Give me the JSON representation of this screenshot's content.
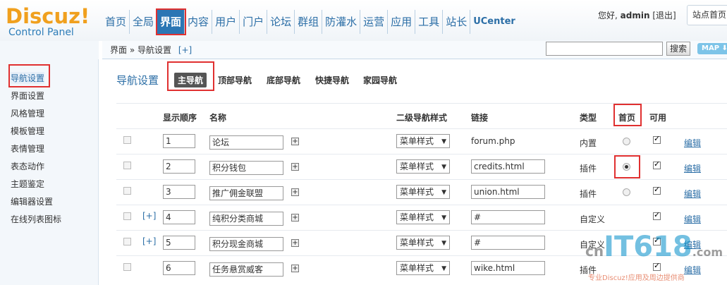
{
  "logo": {
    "main": "Discuz!",
    "sub": "Control Panel"
  },
  "topnav": [
    "首页",
    "全局",
    "界面",
    "内容",
    "用户",
    "门户",
    "论坛",
    "群组",
    "防灌水",
    "运营",
    "应用",
    "工具",
    "站长",
    "UCenter"
  ],
  "user": {
    "greeting": "您好,",
    "name": "admin",
    "logout": "[退出]"
  },
  "site_home": "站点首页",
  "crumb": {
    "path": "界面 » 导航设置",
    "plus": "[+]"
  },
  "search": {
    "button": "搜索",
    "map": "MAP"
  },
  "sidebar": [
    "导航设置",
    "界面设置",
    "风格管理",
    "模板管理",
    "表情管理",
    "表态动作",
    "主题鉴定",
    "编辑器设置",
    "在线列表图标"
  ],
  "main": {
    "title": "导航设置",
    "tabs": [
      "主导航",
      "顶部导航",
      "底部导航",
      "快捷导航",
      "家园导航"
    ]
  },
  "table": {
    "headers": [
      "显示顺序",
      "名称",
      "二级导航样式",
      "链接",
      "类型",
      "首页",
      "可用"
    ],
    "rows": [
      {
        "order": "1",
        "name": "论坛",
        "style": "菜单样式",
        "link": "forum.php",
        "link_editable": false,
        "type": "内置",
        "edit": "编辑"
      },
      {
        "order": "2",
        "name": "积分钱包",
        "style": "菜单样式",
        "link": "credits.html",
        "link_editable": true,
        "type": "插件",
        "edit": "编辑"
      },
      {
        "order": "3",
        "name": "推广佣金联盟",
        "style": "菜单样式",
        "link": "union.html",
        "link_editable": true,
        "type": "插件",
        "edit": "编辑"
      },
      {
        "order": "4",
        "name": "纯积分类商城",
        "style": "菜单样式",
        "link": "#",
        "link_editable": true,
        "type": "自定义",
        "expand": "[+]",
        "edit": "编辑"
      },
      {
        "order": "5",
        "name": "积分现金商城",
        "style": "菜单样式",
        "link": "#",
        "link_editable": true,
        "type": "自定义",
        "expand": "[+]",
        "edit": "编辑"
      },
      {
        "order": "6",
        "name": "任务悬赏威客",
        "style": "菜单样式",
        "link": "wike.html",
        "link_editable": true,
        "type": "插件",
        "edit": "编辑"
      }
    ]
  },
  "watermark": {
    "cn": "cn",
    "brand": "IT618",
    "com": ".com",
    "text": "专业Discuz!应用及周边提供商"
  }
}
